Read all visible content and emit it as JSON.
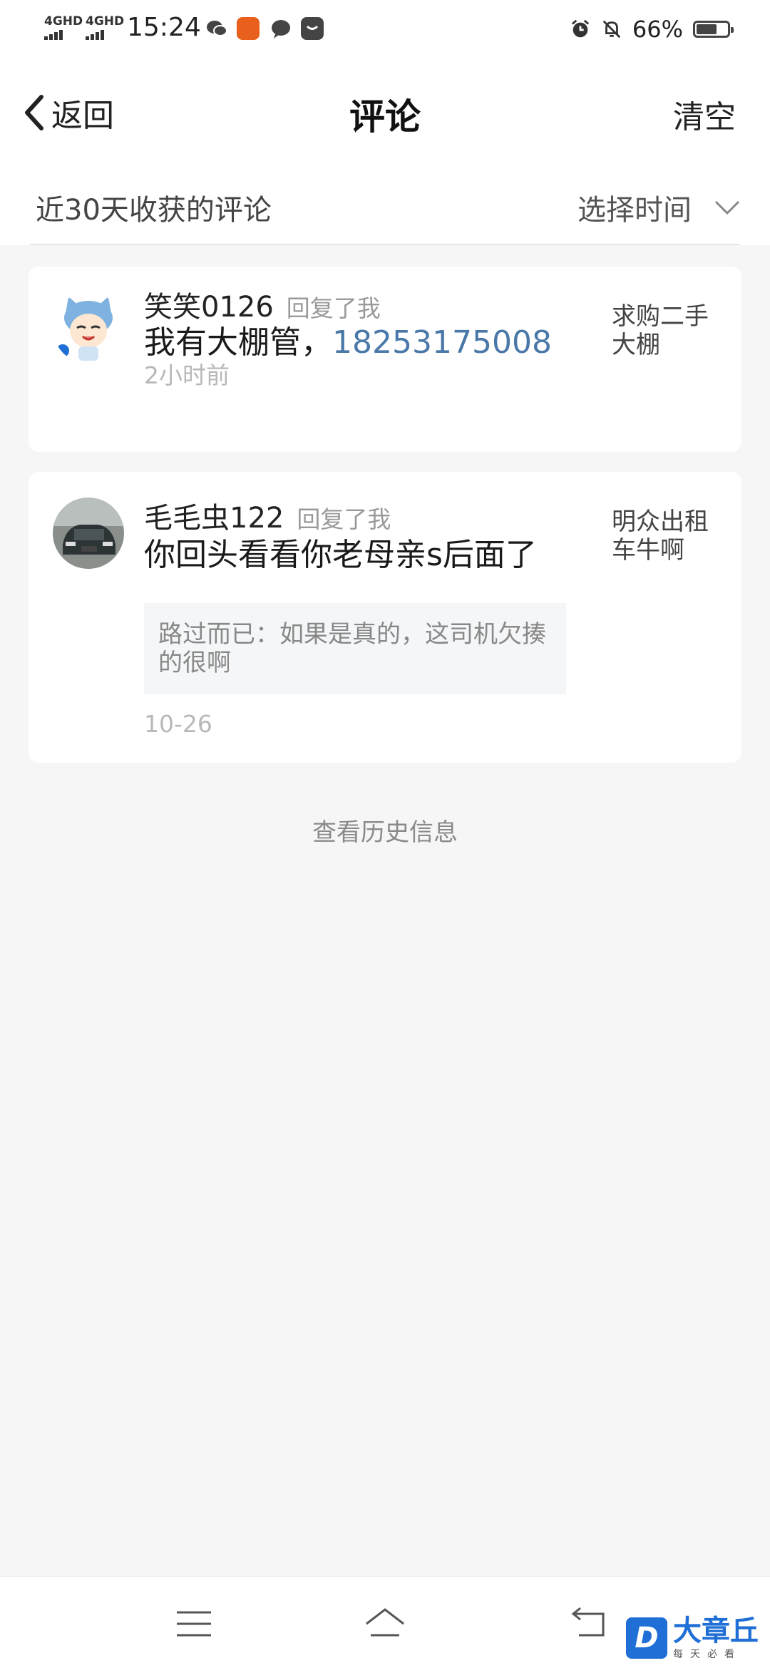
{
  "status_bar": {
    "signal1": "4GHD",
    "signal2": "4GHD",
    "time": "15:24",
    "battery": "66%",
    "battery_level": 0.66
  },
  "header": {
    "back_label": "返回",
    "title": "评论",
    "clear_label": "清空"
  },
  "filter": {
    "label": "近30天收获的评论",
    "time_select": "选择时间"
  },
  "comments": [
    {
      "user": "笑笑0126",
      "reply_tag": "回复了我",
      "content": "我有大棚管，",
      "phone": "18253175008",
      "time": "2小时前",
      "source": "求购二手大棚"
    },
    {
      "user": "毛毛虫122",
      "reply_tag": "回复了我",
      "content": "你回头看看你老母亲s后面了",
      "quote": "路过而已：如果是真的，这司机欠揍的很啊",
      "time": "10-26",
      "source": "明众出租车牛啊"
    }
  ],
  "history_link": "查看历史信息",
  "watermark": {
    "title": "大章丘",
    "subtitle": "每天必看"
  },
  "colors": {
    "link": "#4a78a8",
    "background": "#f6f6f6",
    "brand": "#1f6fd6"
  }
}
